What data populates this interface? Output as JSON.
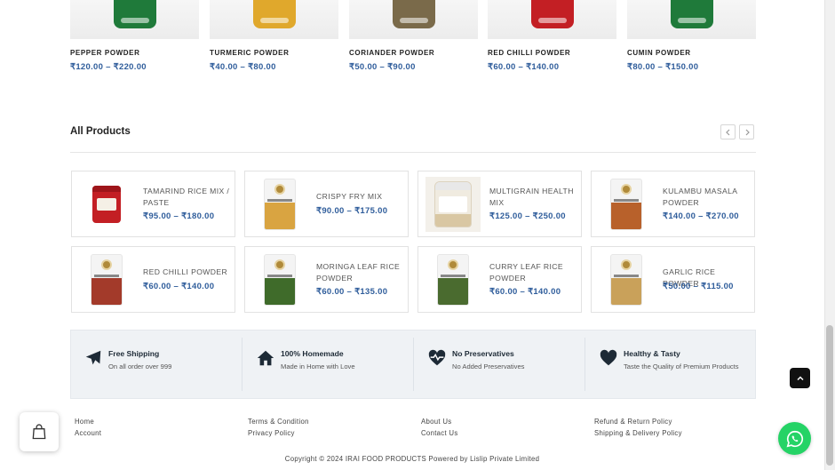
{
  "top_products": [
    {
      "name": "PEPPER POWDER",
      "price": "₹120.00 – ₹220.00",
      "label_color": "#1f7a3a"
    },
    {
      "name": "TURMERIC POWDER",
      "price": "₹40.00 – ₹80.00",
      "label_color": "#e0a82c"
    },
    {
      "name": "CORIANDER POWDER",
      "price": "₹50.00 – ₹90.00",
      "label_color": "#7a6a4a"
    },
    {
      "name": "RED CHILLI POWDER",
      "price": "₹60.00 – ₹140.00",
      "label_color": "#c31f24"
    },
    {
      "name": "CUMIN POWDER",
      "price": "₹80.00 – ₹150.00",
      "label_color": "#1f7a3a"
    }
  ],
  "all_products": {
    "title": "All Products",
    "prev_icon": "chevron-left-icon",
    "next_icon": "chevron-right-icon",
    "items": [
      {
        "name": "TAMARIND RICE MIX / PASTE",
        "price": "₹95.00 – ₹180.00",
        "package": "tin",
        "color": "#c31f24"
      },
      {
        "name": "CRISPY FRY MIX",
        "price": "₹90.00 – ₹175.00",
        "package": "pouch",
        "color": "#d9a441"
      },
      {
        "name": "MULTIGRAIN HEALTH MIX",
        "price": "₹125.00 – ₹250.00",
        "package": "jar",
        "color": "#d9c7a3"
      },
      {
        "name": "KULAMBU MASALA POWDER",
        "price": "₹140.00 – ₹270.00",
        "package": "pouch",
        "color": "#b8612b"
      },
      {
        "name": "RED CHILLI POWDER",
        "price": "₹60.00 – ₹140.00",
        "package": "pouch",
        "color": "#a33a2a"
      },
      {
        "name": "MORINGA LEAF RICE POWDER",
        "price": "₹60.00 – ₹135.00",
        "package": "pouch",
        "color": "#3f6b2a"
      },
      {
        "name": "CURRY LEAF RICE POWDER",
        "price": "₹60.00 – ₹140.00",
        "package": "pouch",
        "color": "#4a6b2f"
      },
      {
        "name": "GARLIC RICE POWDER",
        "price": "₹50.00 – ₹115.00",
        "package": "pouch",
        "color": "#c9a15a"
      }
    ]
  },
  "features": [
    {
      "icon": "airplane-icon",
      "title": "Free Shipping",
      "subtitle": "On all order over 999"
    },
    {
      "icon": "home-icon",
      "title": "100% Homemade",
      "subtitle": "Made in Home with Love"
    },
    {
      "icon": "heartbeat-icon",
      "title": "No Preservatives",
      "subtitle": "No Added Preservatives"
    },
    {
      "icon": "heart-icon",
      "title": "Healthy & Tasty",
      "subtitle": "Taste the Quality of Premium Products"
    }
  ],
  "footer": {
    "links": [
      {
        "label": "Home"
      },
      {
        "label": "Account"
      },
      {
        "label": "Terms & Condition"
      },
      {
        "label": "Privacy Policy"
      },
      {
        "label": "About Us"
      },
      {
        "label": "Contact Us"
      },
      {
        "label": "Refund & Return Policy"
      },
      {
        "label": "Shipping & Delivery Policy"
      }
    ],
    "copyright": "Copyright © 2024 IRAI FOOD PRODUCTS Powered by Lislip Private Limited"
  },
  "floating": {
    "cart_icon": "shopping-bag-icon",
    "scroll_top_icon": "chevron-up-icon",
    "whatsapp_icon": "whatsapp-icon"
  },
  "colors": {
    "price": "#2f5d9b",
    "features_bg": "#eff2f5",
    "icon_dark": "#1d2a36",
    "whatsapp": "#25d366"
  }
}
